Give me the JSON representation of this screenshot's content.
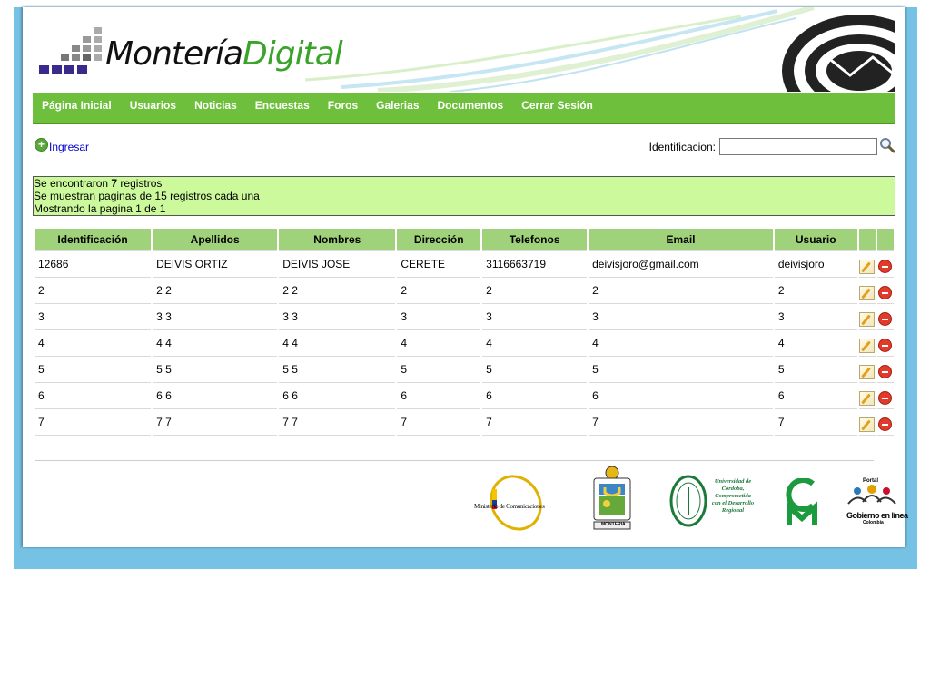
{
  "logo": {
    "part1": "Montería",
    "part2": "Digital"
  },
  "nav": {
    "items": [
      "Página Inicial",
      "Usuarios",
      "Noticias",
      "Encuestas",
      "Foros",
      "Galerias",
      "Documentos",
      "Cerrar Sesión"
    ]
  },
  "toolbar": {
    "ingresar": "Ingresar",
    "search_label": "Identificacion:",
    "search_value": ""
  },
  "info": {
    "line1_pre": "Se encontraron ",
    "count": "7",
    "line1_post": " registros",
    "line2": "Se muestran paginas de 15 registros cada una",
    "line3": "Mostrando la pagina 1 de 1"
  },
  "table": {
    "headers": [
      "Identificación",
      "Apellidos",
      "Nombres",
      "Dirección",
      "Telefonos",
      "Email",
      "Usuario"
    ],
    "rows": [
      [
        "12686",
        "DEIVIS ORTIZ",
        "DEIVIS JOSE",
        "CERETE",
        "3116663719",
        "deivisjoro@gmail.com",
        "deivisjoro"
      ],
      [
        "2",
        "2 2",
        "2 2",
        "2",
        "2",
        "2",
        "2"
      ],
      [
        "3",
        "3 3",
        "3 3",
        "3",
        "3",
        "3",
        "3"
      ],
      [
        "4",
        "4 4",
        "4 4",
        "4",
        "4",
        "4",
        "4"
      ],
      [
        "5",
        "5 5",
        "5 5",
        "5",
        "5",
        "5",
        "5"
      ],
      [
        "6",
        "6 6",
        "6 6",
        "6",
        "6",
        "6",
        "6"
      ],
      [
        "7",
        "7 7",
        "7 7",
        "7",
        "7",
        "7",
        "7"
      ]
    ]
  },
  "sponsors": {
    "mintic": "Ministerio de Comunicaciones",
    "monteria": "MONTERIA",
    "unicordoba": "Universidad de Córdoba, Comprometida con el Desarrollo Regional",
    "gobierno_top": "Portal",
    "gobierno": "Gobierno en línea",
    "gobierno_sub": "Colombia"
  },
  "colors": {
    "nav": "#6ec03c",
    "header_cell": "#9fd27a",
    "info_bg": "#ccf99c",
    "frame": "#76c2e4"
  }
}
